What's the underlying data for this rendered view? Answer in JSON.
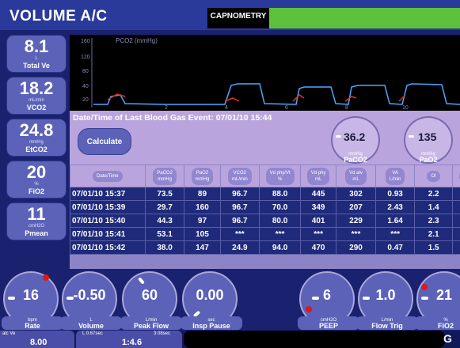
{
  "header": {
    "mode": "VOLUME A/C",
    "tab": "CAPNOMETRY"
  },
  "tiles": [
    {
      "value": "8.1",
      "unit": "L",
      "name": "Total Ve"
    },
    {
      "value": "18.2",
      "unit": "mL/min",
      "name": "VCO2"
    },
    {
      "value": "24.8",
      "unit": "mmHg",
      "name": "EtCO2"
    },
    {
      "value": "20",
      "unit": "%",
      "name": "FiO2"
    },
    {
      "value": "11",
      "unit": "cmH2O",
      "name": "Pmean"
    }
  ],
  "waveform": {
    "title": "PCO2 (mmHg)",
    "y_ticks": [
      "160",
      "120",
      "80",
      "40",
      "20"
    ],
    "x_ticks": [
      "2",
      "4",
      "6",
      "8",
      "10"
    ],
    "colors": {
      "line": "#4aa8ff",
      "inspiration": "#e03030"
    }
  },
  "blood_gas": {
    "title": "Date/Time of Last Blood Gas Event:",
    "event": "07/01/10 15:44",
    "calc_label": "Calculate",
    "paco2": {
      "value": "36.2",
      "unit": "mmHg",
      "name": "PaCO2"
    },
    "pao2": {
      "value": "135",
      "unit": "mmHg",
      "name": "PaO2"
    }
  },
  "table": {
    "headers": [
      [
        "Date/Time",
        ""
      ],
      [
        "PaCO2",
        "mmHg"
      ],
      [
        "PaO2",
        "mmHg"
      ],
      [
        "VCO2",
        "mL/min"
      ],
      [
        "Vd phy/Vt",
        "%"
      ],
      [
        "Vd phy",
        "mL"
      ],
      [
        "Vd alv",
        "mL"
      ],
      [
        "VA",
        "L/min"
      ],
      [
        "OI",
        ""
      ],
      [
        "P/F",
        ""
      ]
    ],
    "rows": [
      [
        "07/01/10 15:37",
        "73.5",
        "89",
        "96.7",
        "88.0",
        "445",
        "302",
        "0.93",
        "2.2",
        "44"
      ],
      [
        "07/01/10 15:39",
        "29.7",
        "160",
        "96.7",
        "70.0",
        "349",
        "207",
        "2.43",
        "1.4",
        "80"
      ],
      [
        "07/01/10 15:40",
        "44.3",
        "97",
        "96.7",
        "80.0",
        "401",
        "229",
        "1.64",
        "2.3",
        "48"
      ],
      [
        "07/01/10 15:41",
        "53.1",
        "105",
        "***",
        "***",
        "***",
        "***",
        "***",
        "2.1",
        "52"
      ],
      [
        "07/01/10 15:42",
        "38.0",
        "147",
        "24.9",
        "94.0",
        "470",
        "290",
        "0.47",
        "1.5",
        "73"
      ]
    ]
  },
  "dials": [
    {
      "value": "16",
      "unit": "bpm",
      "name": "Rate"
    },
    {
      "value": "-0.50",
      "unit": "L",
      "name": "Volume"
    },
    {
      "value": "60",
      "unit": "L/min",
      "name": "Peak Flow"
    },
    {
      "value": "0.00",
      "unit": "sec",
      "name": "Insp Pause"
    },
    {
      "value": "6",
      "unit": "cmH2O",
      "name": "PEEP"
    },
    {
      "value": "1.0",
      "unit": "L/min",
      "name": "Flow Trig"
    },
    {
      "value": "21",
      "unit": "%",
      "name": "FiO2"
    }
  ],
  "status": {
    "ve_label": "alc Ve",
    "ve_value": "8.00",
    "ti_label": "L 0.67sec",
    "te_label": "3.08sec",
    "ie_value": "1:4.6"
  }
}
